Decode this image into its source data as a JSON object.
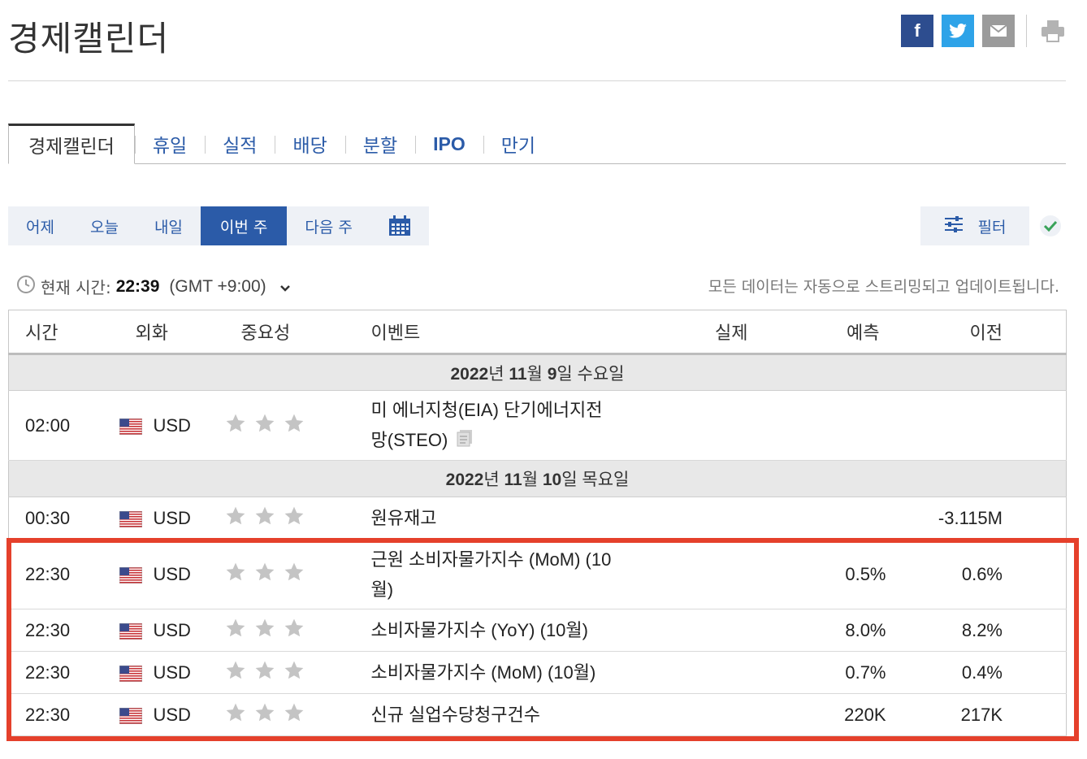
{
  "page_title": "경제캘린더",
  "share": {
    "facebook_label": "f",
    "icons": [
      "facebook-icon",
      "twitter-icon",
      "mail-icon",
      "print-icon"
    ]
  },
  "tabs": [
    {
      "label": "경제캘린더",
      "active": true
    },
    {
      "label": "휴일"
    },
    {
      "label": "실적"
    },
    {
      "label": "배당"
    },
    {
      "label": "분할"
    },
    {
      "label": "IPO"
    },
    {
      "label": "만기"
    }
  ],
  "date_filters": [
    {
      "label": "어제"
    },
    {
      "label": "오늘"
    },
    {
      "label": "내일"
    },
    {
      "label": "이번 주",
      "active": true
    },
    {
      "label": "다음 주"
    }
  ],
  "filter_label": "필터",
  "current_time": {
    "prefix": "현재 시간:",
    "time": "22:39",
    "gmt": "(GMT +9:00)"
  },
  "streaming_note": "모든 데이터는 자동으로 스트리밍되고 업데이트됩니다.",
  "table": {
    "headers": {
      "time": "시간",
      "currency": "외화",
      "importance": "중요성",
      "event": "이벤트",
      "actual": "실제",
      "forecast": "예측",
      "previous": "이전"
    },
    "date_groups": [
      {
        "year": "2022",
        "month": "11",
        "day": "9",
        "weekday": "수요일"
      },
      {
        "year": "2022",
        "month": "11",
        "day": "10",
        "weekday": "목요일"
      }
    ],
    "rows": [
      {
        "time": "02:00",
        "currency": "USD",
        "event_line1": "미 에너지청(EIA) 단기에너지전",
        "event_line2": "망(STEO)",
        "actual": "",
        "forecast": "",
        "previous": ""
      },
      {
        "time": "00:30",
        "currency": "USD",
        "event": "원유재고",
        "actual": "",
        "forecast": "",
        "previous": "-3.115M"
      },
      {
        "time": "22:30",
        "currency": "USD",
        "event_line1": "근원 소비자물가지수 (MoM) (10",
        "event_line2": "월)",
        "actual": "",
        "forecast": "0.5%",
        "previous": "0.6%"
      },
      {
        "time": "22:30",
        "currency": "USD",
        "event": "소비자물가지수 (YoY) (10월)",
        "actual": "",
        "forecast": "8.0%",
        "previous": "8.2%"
      },
      {
        "time": "22:30",
        "currency": "USD",
        "event": "소비자물가지수 (MoM) (10월)",
        "actual": "",
        "forecast": "0.7%",
        "previous": "0.4%"
      },
      {
        "time": "22:30",
        "currency": "USD",
        "event": "신규 실업수당청구건수",
        "actual": "",
        "forecast": "220K",
        "previous": "217K"
      }
    ]
  },
  "colors": {
    "accent": "#2b5ba8",
    "highlight_border": "#e5402b",
    "star": "#c4c4c4"
  }
}
